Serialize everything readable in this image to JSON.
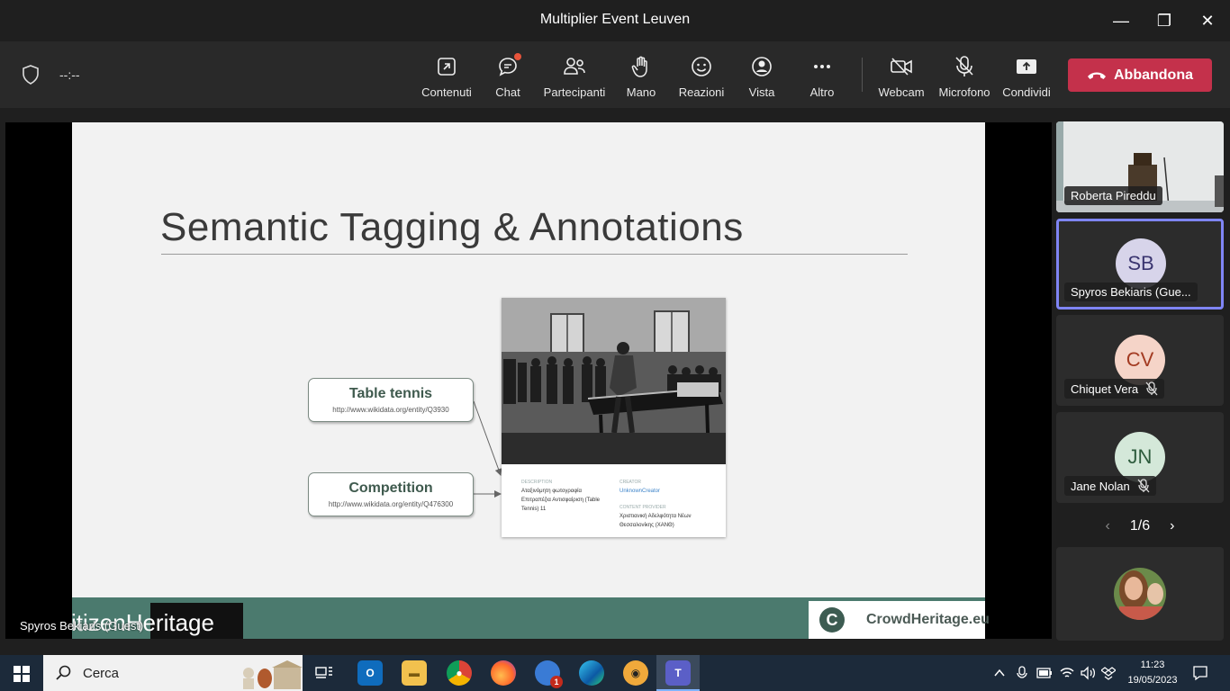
{
  "window": {
    "title": "Multiplier Event Leuven",
    "minimize": "—",
    "maximize": "❐",
    "close": "✕"
  },
  "meeting": {
    "timer": "--:--"
  },
  "toolbar": {
    "items": [
      {
        "label": "Contenuti",
        "icon": "share-content-icon"
      },
      {
        "label": "Chat",
        "icon": "chat-icon"
      },
      {
        "label": "Partecipanti",
        "icon": "participants-icon"
      },
      {
        "label": "Mano",
        "icon": "raise-hand-icon"
      },
      {
        "label": "Reazioni",
        "icon": "reactions-icon"
      },
      {
        "label": "Vista",
        "icon": "view-icon"
      },
      {
        "label": "Altro",
        "icon": "more-icon"
      },
      {
        "label": "Webcam",
        "icon": "camera-off-icon"
      },
      {
        "label": "Microfono",
        "icon": "mic-off-icon"
      },
      {
        "label": "Condividi",
        "icon": "share-icon"
      }
    ],
    "leave_label": "Abbandona",
    "accent": "#c4314b"
  },
  "slide": {
    "title": "Semantic Tagging & Annotations",
    "tags": [
      {
        "label": "Table tennis",
        "url": "http://www.wikidata.org/entity/Q3930"
      },
      {
        "label": "Competition",
        "url": "http://www.wikidata.org/entity/Q476300"
      }
    ],
    "card": {
      "description_key": "DESCRIPTION",
      "description": "Αταξινόμητη φωτογραφία Επιτραπέζια Αντισφαίριση (Table Tennis) 11",
      "creator_key": "CREATOR",
      "creator": "UnknownCreator",
      "provider_key": "CONTENT PROVIDER",
      "provider": "Χριστιανική Αδελφότητα Νέων Θεσσαλονίκης (ΧΑΝΘ)"
    },
    "footer_left": "itizenHeritage",
    "footer_right": "CrowdHeritage.eu",
    "footer_logo": "C",
    "footer_color": "#4b7a6e"
  },
  "speaker": "Spyros Bekiaris (Guest)",
  "participants": [
    {
      "name": "Roberta Pireddu",
      "initials": "",
      "video": true,
      "muted": false
    },
    {
      "name": "Spyros Bekiaris (Gue...",
      "initials": "SB",
      "muted": false,
      "active": true,
      "avatar_color": "#d7d4ea",
      "text_color": "#3a3570"
    },
    {
      "name": "Chiquet Vera",
      "initials": "CV",
      "muted": true,
      "avatar_color": "#f5d4c8",
      "text_color": "#a33b22"
    },
    {
      "name": "Jane Nolan",
      "initials": "JN",
      "muted": true,
      "avatar_color": "#d4e8d9",
      "text_color": "#2e5c3d"
    }
  ],
  "pager": {
    "text": "1/6",
    "prev": "‹",
    "next": "›"
  },
  "taskbar": {
    "search_placeholder": "Cerca",
    "time": "11:23",
    "date": "19/05/2023",
    "notification_badge": "1"
  }
}
